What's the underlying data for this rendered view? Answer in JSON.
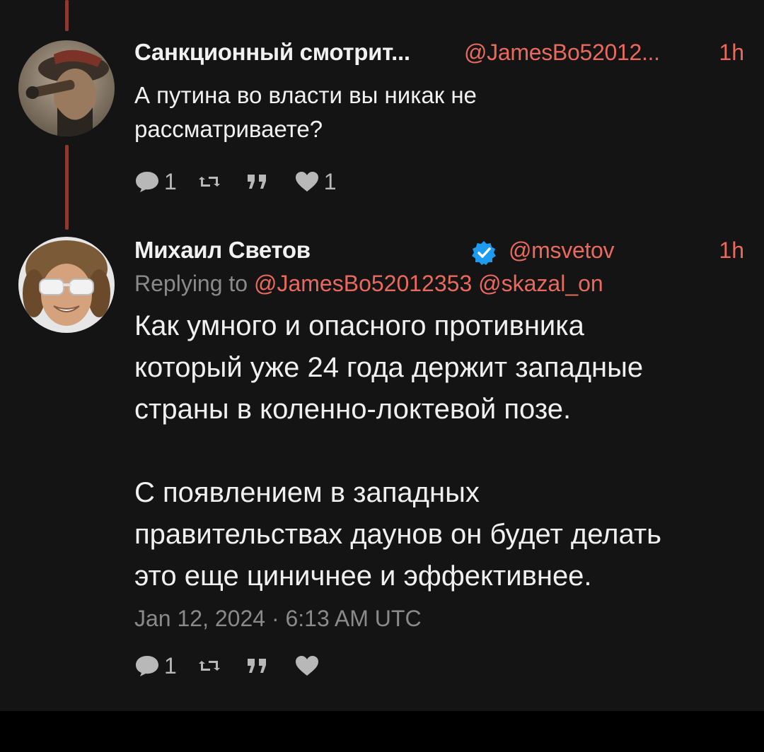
{
  "tweet1": {
    "author_name": "Санкционный смотрит...",
    "handle": "@JamesBo52012...",
    "time": "1h",
    "text": "А путина во власти вы никак не\nрассматриваете?",
    "reply_count": "1",
    "retweet_count": "",
    "quote_count": "",
    "like_count": "1"
  },
  "tweet2": {
    "author_name": "Михаил Светов",
    "handle": "@msvetov",
    "time": "1h",
    "reply_prefix": "Replying to",
    "reply_mentions": [
      "@JamesBo52012353",
      "@skazal_on"
    ],
    "text": "Как умного и опасного противника\nкоторый уже 24 года держит западные\nстраны в коленно-локтевой позе.\n\nС появлением в западных\nправительствах даунов он будет делать\nэто еще циничнее и эффективнее.",
    "timestamp": "Jan 12, 2024 · 6:13 AM UTC",
    "reply_count": "1",
    "retweet_count": "",
    "quote_count": "",
    "like_count": ""
  },
  "icons": {
    "reply": "comment-icon",
    "retweet": "retweet-icon",
    "quote": "quote-icon",
    "like": "heart-icon",
    "verified": "verified-badge-icon"
  },
  "colors": {
    "background": "#141414",
    "accent": "#e96a5d",
    "thread_line": "#8b3a32",
    "muted": "#8a8a8a",
    "verified": "#1d9bf0"
  }
}
